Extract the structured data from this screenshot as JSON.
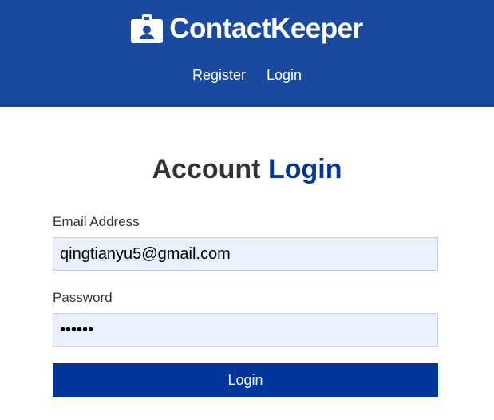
{
  "navbar": {
    "brand_icon": "id-badge-icon",
    "brand_title": "ContactKeeper",
    "links": [
      {
        "label": "Register"
      },
      {
        "label": "Login"
      }
    ]
  },
  "form": {
    "heading_plain": "Account ",
    "heading_accent": "Login",
    "email_label": "Email Address",
    "email_value": "qingtianyu5@gmail.com",
    "password_label": "Password",
    "password_value": "123456",
    "submit_label": "Login"
  },
  "colors": {
    "navbar_bg": "#1a4aa0",
    "accent": "#003699",
    "input_bg": "#e8f0fe"
  }
}
